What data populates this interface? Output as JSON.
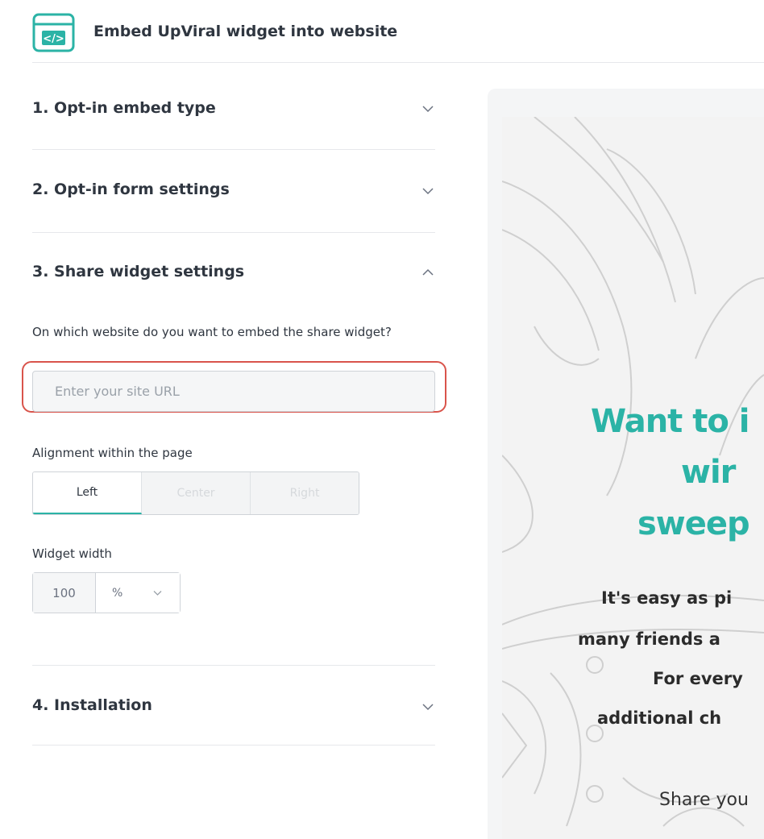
{
  "header": {
    "title": "Embed UpViral widget into website",
    "icon": "code-window-icon",
    "accent": "#2bb3a6"
  },
  "sections": [
    {
      "title": "1. Opt-in embed type",
      "expanded": false
    },
    {
      "title": "2. Opt-in form settings",
      "expanded": false
    },
    {
      "title": "3. Share widget settings",
      "expanded": true
    },
    {
      "title": "4. Installation",
      "expanded": false
    }
  ],
  "share_settings": {
    "question": "On which website do you want to embed the share widget?",
    "url_input": {
      "value": "",
      "placeholder": "Enter your site URL"
    },
    "alignment_label": "Alignment within the page",
    "alignment_options": [
      "Left",
      "Center",
      "Right"
    ],
    "alignment_selected": "Left",
    "width_label": "Widget width",
    "width_value": "100",
    "width_unit": "%"
  },
  "preview": {
    "headline_1": "Want to i",
    "headline_2": "wir",
    "headline_3": "sweep",
    "body_1": "It's easy as pi",
    "body_2": "many friends a",
    "body_3": "For every",
    "body_4": "additional ch",
    "share": "Share you",
    "headline_color": "#2bb3a6"
  },
  "colors": {
    "highlight": "#d9544b",
    "accent": "#2bb3a6"
  }
}
